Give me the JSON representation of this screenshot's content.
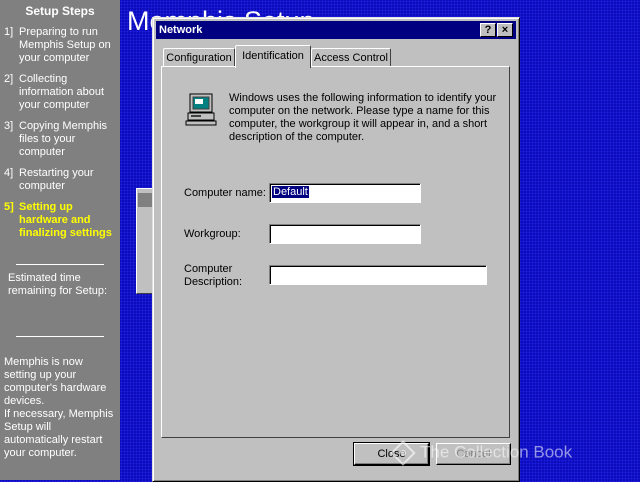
{
  "sidebar": {
    "heading": "Setup Steps",
    "steps": [
      {
        "num": "1]",
        "label": "Preparing to run Memphis Setup on your computer"
      },
      {
        "num": "2]",
        "label": "Collecting information about your computer"
      },
      {
        "num": "3]",
        "label": "Copying Memphis files to your computer"
      },
      {
        "num": "4]",
        "label": "Restarting your computer"
      },
      {
        "num": "5]",
        "label": "Setting up hardware and finalizing settings"
      }
    ],
    "estimated_label": "Estimated time remaining for Setup:",
    "status_text": "Memphis is now setting up your computer's hardware devices.",
    "restart_text": "If necessary, Memphis Setup will automatically restart your computer."
  },
  "background": {
    "title": "Memphis Setup"
  },
  "dialog": {
    "title": "Network",
    "help_glyph": "?",
    "close_glyph": "×",
    "tabs": [
      "Configuration",
      "Identification",
      "Access Control"
    ],
    "active_tab": "Identification",
    "intro": "Windows uses the following information to identify your computer on the network.  Please type a name for this computer, the workgroup it will appear in, and a short description of the computer.",
    "computer_name_label": "Computer name:",
    "computer_name_value": "Default",
    "workgroup_label": "Workgroup:",
    "workgroup_value": "",
    "description_label": "Computer Description:",
    "description_value": "",
    "close_label": "Close",
    "cancel_label": "Cancel"
  },
  "watermark": "The Collection Book",
  "colors": {
    "desktop": "#0a0ab8",
    "sidebar": "#808080",
    "active_step": "#ffff00",
    "titlebar": "#000080",
    "dialog_face": "#c0c0c0"
  },
  "icons": [
    "network-computer-icon",
    "help-icon",
    "close-icon",
    "mouse-pointer-icon"
  ]
}
